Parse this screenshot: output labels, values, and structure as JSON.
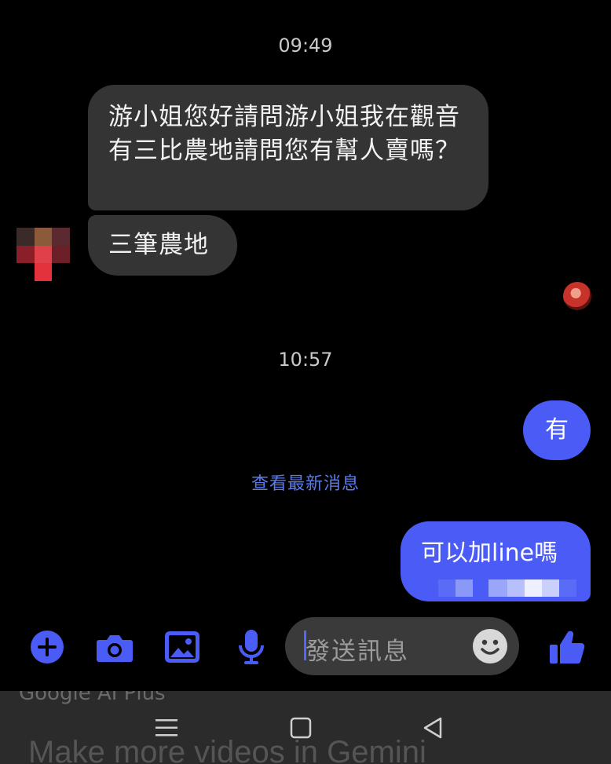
{
  "conversation": {
    "timestamps": [
      "09:49",
      "10:57"
    ],
    "incoming": [
      {
        "text": "游小姐您好請問游小姐我在觀音有三比農地請問您有幫人賣嗎？"
      },
      {
        "text": "三筆農地"
      }
    ],
    "outgoing": [
      {
        "text": "有"
      },
      {
        "text": "可以加line嗎"
      }
    ],
    "view_latest_label": "查看最新消息"
  },
  "composer": {
    "placeholder": "發送訊息",
    "icons": [
      "plus-circle-icon",
      "camera-icon",
      "image-icon",
      "microphone-icon",
      "emoji-icon",
      "thumbs-up-icon"
    ],
    "accent_color": "#4a5cf5"
  },
  "background_overlay": {
    "line1": "Google AI Plus",
    "line2": "Make more videos in Gemini"
  },
  "colors": {
    "incoming_bubble": "#343434",
    "outgoing_bubble": "#4a5cf5",
    "link": "#5b7bea"
  }
}
